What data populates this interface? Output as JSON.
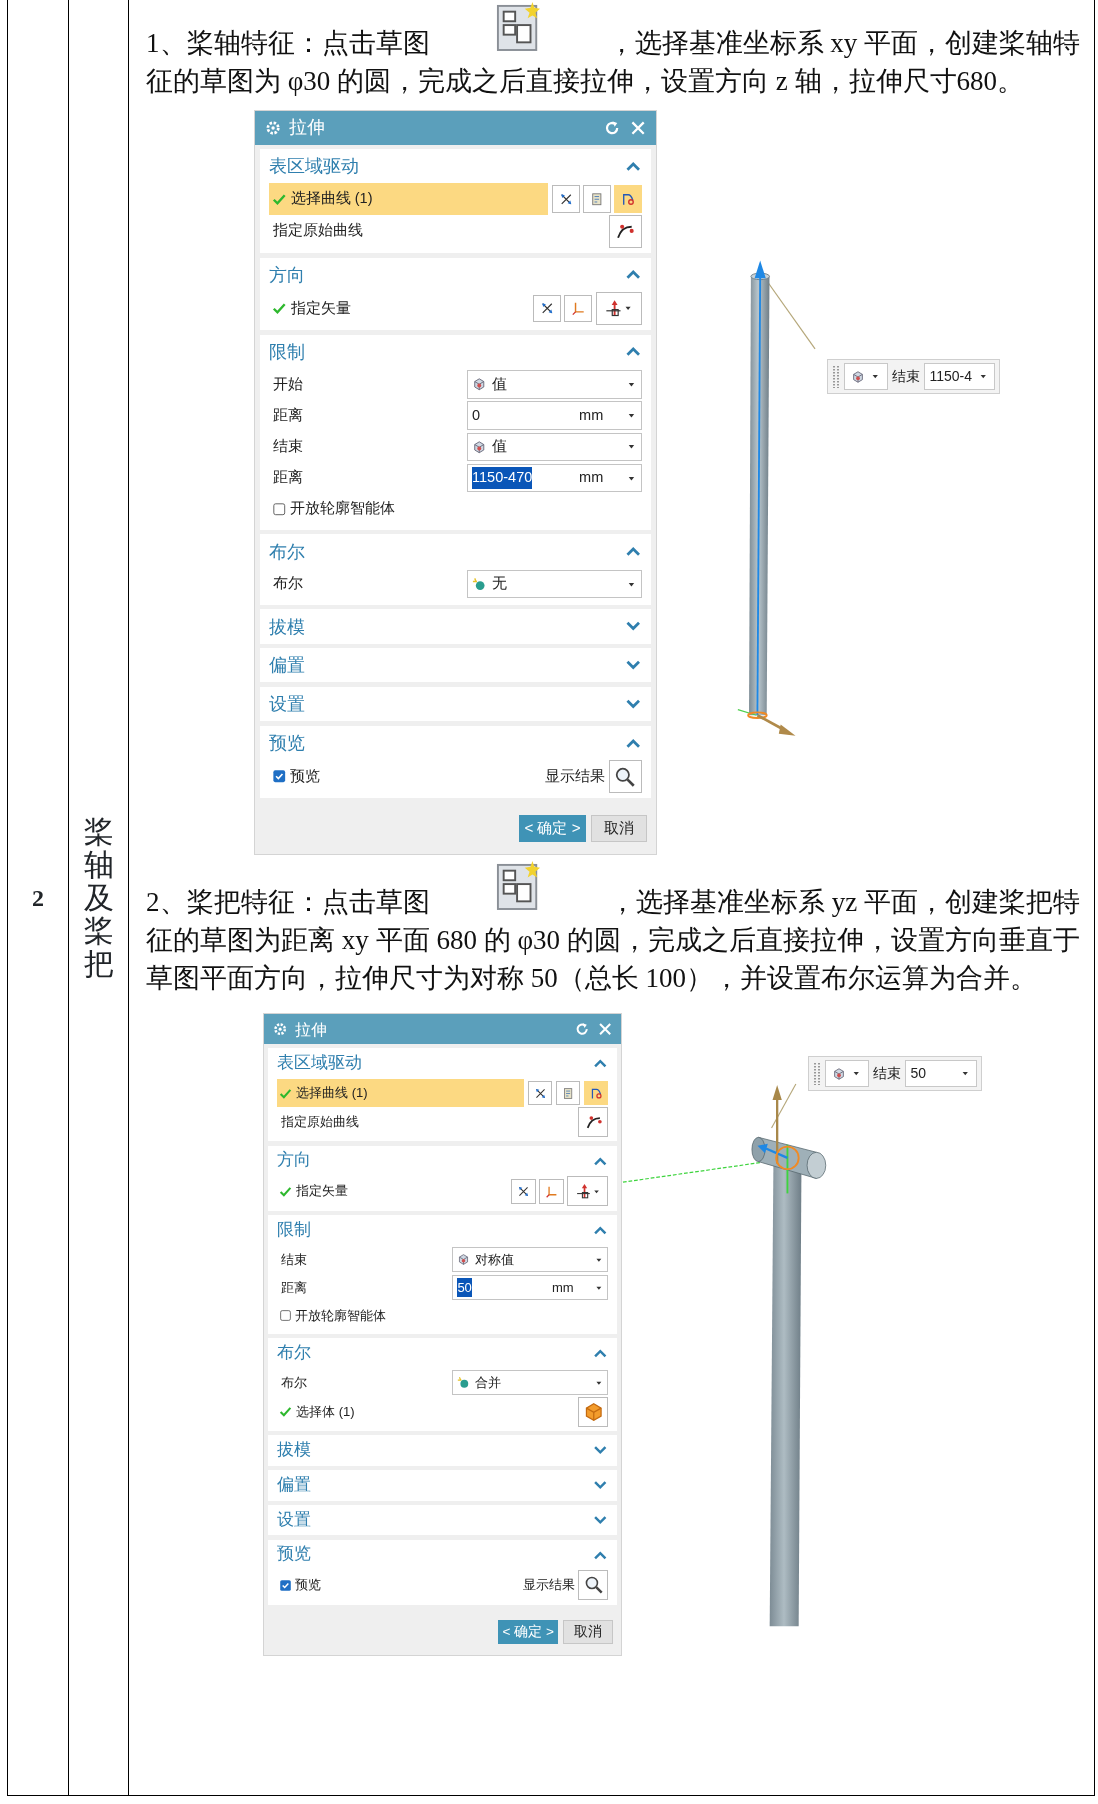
{
  "table": {
    "row_number": "2",
    "row_title": "桨轴及桨把",
    "steps": [
      {
        "text_before": "1、桨轴特征：点击草图",
        "text_after": "，选择基准坐标系 xy 平面，创建桨轴特",
        "continuation": "征的草图为 φ30 的圆，完成之后直接拉伸，设置方向 z 轴，拉伸尺寸680。",
        "dialog": {
          "title": "拉伸",
          "sections": [
            {
              "title": "表区域驱动",
              "expanded": true,
              "rows": [
                {
                  "kind": "curve_select",
                  "label": "选择曲线 (1)",
                  "done": true,
                  "highlighted": true
                },
                {
                  "kind": "curve_pick",
                  "label": "指定原始曲线"
                }
              ]
            },
            {
              "title": "方向",
              "expanded": true,
              "rows": [
                {
                  "kind": "vector",
                  "label": "指定矢量",
                  "done": true
                }
              ]
            },
            {
              "title": "限制",
              "expanded": true,
              "rows": [
                {
                  "kind": "mode",
                  "label": "开始",
                  "value": "值"
                },
                {
                  "kind": "distance",
                  "label": "距离",
                  "value": "0",
                  "unit": "mm",
                  "value_selected": false
                },
                {
                  "kind": "mode",
                  "label": "结束",
                  "value": "值"
                },
                {
                  "kind": "distance",
                  "label": "距离",
                  "value": "1150-470",
                  "unit": "mm",
                  "value_selected": true
                },
                {
                  "kind": "checkbox",
                  "label": "开放轮廓智能体",
                  "checked": false
                }
              ]
            },
            {
              "title": "布尔",
              "expanded": true,
              "rows": [
                {
                  "kind": "boolean",
                  "label": "布尔",
                  "value": "无"
                }
              ]
            },
            {
              "title": "拔模",
              "expanded": false
            },
            {
              "title": "偏置",
              "expanded": false
            },
            {
              "title": "设置",
              "expanded": false
            },
            {
              "title": "预览",
              "expanded": true,
              "rows": [
                {
                  "kind": "preview",
                  "label": "预览",
                  "checked": true,
                  "action": "显示结果"
                }
              ]
            }
          ],
          "ok": "< 确定 >",
          "cancel": "取消"
        },
        "viewport": {
          "kind": "shaft",
          "toolbar": {
            "label": "结束",
            "value": "1150-4"
          }
        }
      },
      {
        "text_before": "2、桨把特征：点击草图",
        "text_after": "，选择基准坐标系 yz 平面，创建桨把特",
        "continuation": "征的草图为距离 xy 平面 680 的 φ30 的圆，完成之后直接拉伸，设置方向垂直于草图平面方向，拉伸尺寸为对称 50（总长 100），并设置布尔运算为合并。",
        "dialog": {
          "title": "拉伸",
          "sections": [
            {
              "title": "表区域驱动",
              "expanded": true,
              "rows": [
                {
                  "kind": "curve_select",
                  "label": "选择曲线 (1)",
                  "done": true,
                  "highlighted": true
                },
                {
                  "kind": "curve_pick",
                  "label": "指定原始曲线"
                }
              ]
            },
            {
              "title": "方向",
              "expanded": true,
              "rows": [
                {
                  "kind": "vector",
                  "label": "指定矢量",
                  "done": true
                }
              ]
            },
            {
              "title": "限制",
              "expanded": true,
              "rows": [
                {
                  "kind": "mode",
                  "label": "结束",
                  "value": "对称值"
                },
                {
                  "kind": "distance",
                  "label": "距离",
                  "value": "50",
                  "unit": "mm",
                  "value_selected": true
                },
                {
                  "kind": "checkbox",
                  "label": "开放轮廓智能体",
                  "checked": false
                }
              ]
            },
            {
              "title": "布尔",
              "expanded": true,
              "rows": [
                {
                  "kind": "boolean",
                  "label": "布尔",
                  "value": "合并"
                },
                {
                  "kind": "body_select",
                  "label": "选择体 (1)",
                  "done": true
                }
              ]
            },
            {
              "title": "拔模",
              "expanded": false
            },
            {
              "title": "偏置",
              "expanded": false
            },
            {
              "title": "设置",
              "expanded": false
            },
            {
              "title": "预览",
              "expanded": true,
              "rows": [
                {
                  "kind": "preview",
                  "label": "预览",
                  "checked": true,
                  "action": "显示结果"
                }
              ]
            }
          ],
          "ok": "< 确定 >",
          "cancel": "取消"
        },
        "viewport": {
          "kind": "shaft_with_handle",
          "toolbar": {
            "label": "结束",
            "value": "50"
          }
        }
      }
    ]
  }
}
